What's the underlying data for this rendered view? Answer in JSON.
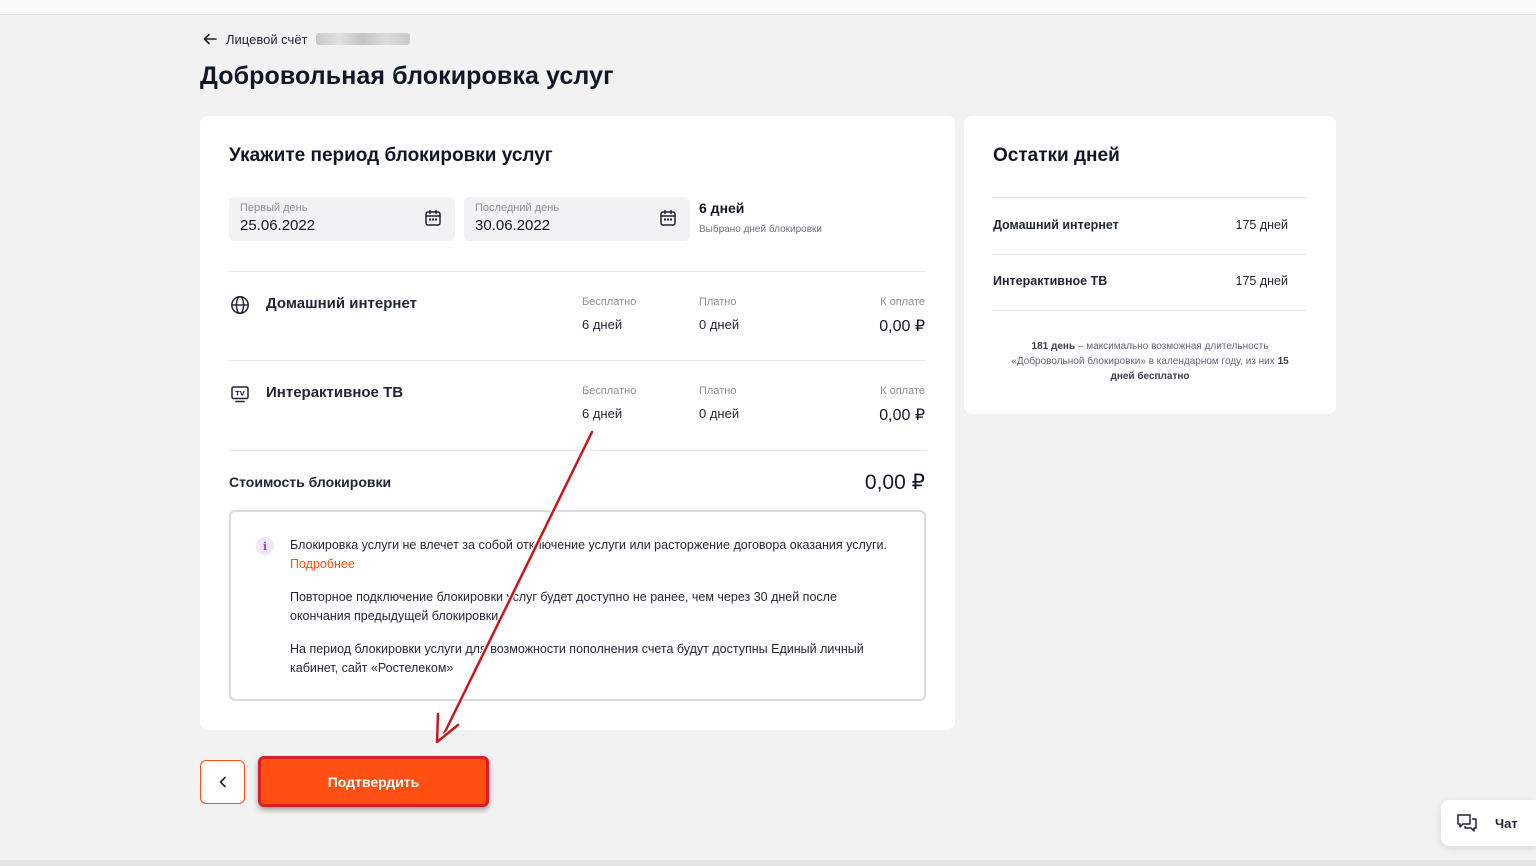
{
  "breadcrumb": {
    "label": "Лицевой счёт"
  },
  "page_title": "Добровольная блокировка услуг",
  "period": {
    "title": "Укажите период блокировки услуг",
    "first_day_label": "Первый день",
    "first_day_value": "25.06.2022",
    "last_day_label": "Последний день",
    "last_day_value": "30.06.2022",
    "days_count": "6 дней",
    "days_caption": "Выбрано дней блокировки"
  },
  "services": [
    {
      "name": "Домашний интернет",
      "icon": "globe-icon",
      "free_label": "Бесплатно",
      "free_value": "6 дней",
      "paid_label": "Платно",
      "paid_value": "0 дней",
      "pay_label": "К оплате",
      "pay_value": "0,00 ₽"
    },
    {
      "name": "Интерактивное ТВ",
      "icon": "tv-icon",
      "free_label": "Бесплатно",
      "free_value": "6 дней",
      "paid_label": "Платно",
      "paid_value": "0 дней",
      "pay_label": "К оплате",
      "pay_value": "0,00 ₽"
    }
  ],
  "cost": {
    "label": "Стоимость блокировки",
    "value": "0,00 ₽"
  },
  "info": {
    "icon_glyph": "i",
    "p1": "Блокировка услуги не влечет за собой отключение услуги или расторжение договора оказания услуги.",
    "p1_link": "Подробнее",
    "p2": "Повторное подключение блокировки услуг будет доступно не ранее, чем через 30 дней после окончания предыдущей блокировки.",
    "p3": "На период блокировки услуги для возможности пополнения счета будут доступны Единый личный кабинет, сайт «Ростелеком»"
  },
  "remaining": {
    "title": "Остатки дней",
    "rows": [
      {
        "label": "Домашний интернет",
        "value": "175 дней"
      },
      {
        "label": "Интерактивное ТВ",
        "value": "175 дней"
      }
    ],
    "note_bold_1": "181 день",
    "note_1": " – максимально возможная длительность «Добровольной блокировки» в календарном году, из них ",
    "note_bold_2": "15 дней бесплатно"
  },
  "actions": {
    "confirm_label": "Подтвердить",
    "back_icon": "chevron-left-icon"
  },
  "chat": {
    "label": "Чат",
    "icon": "chat-icon"
  },
  "colors": {
    "accent": "#ff4f12",
    "highlight": "#d61f26",
    "background": "#f2f2f2"
  }
}
